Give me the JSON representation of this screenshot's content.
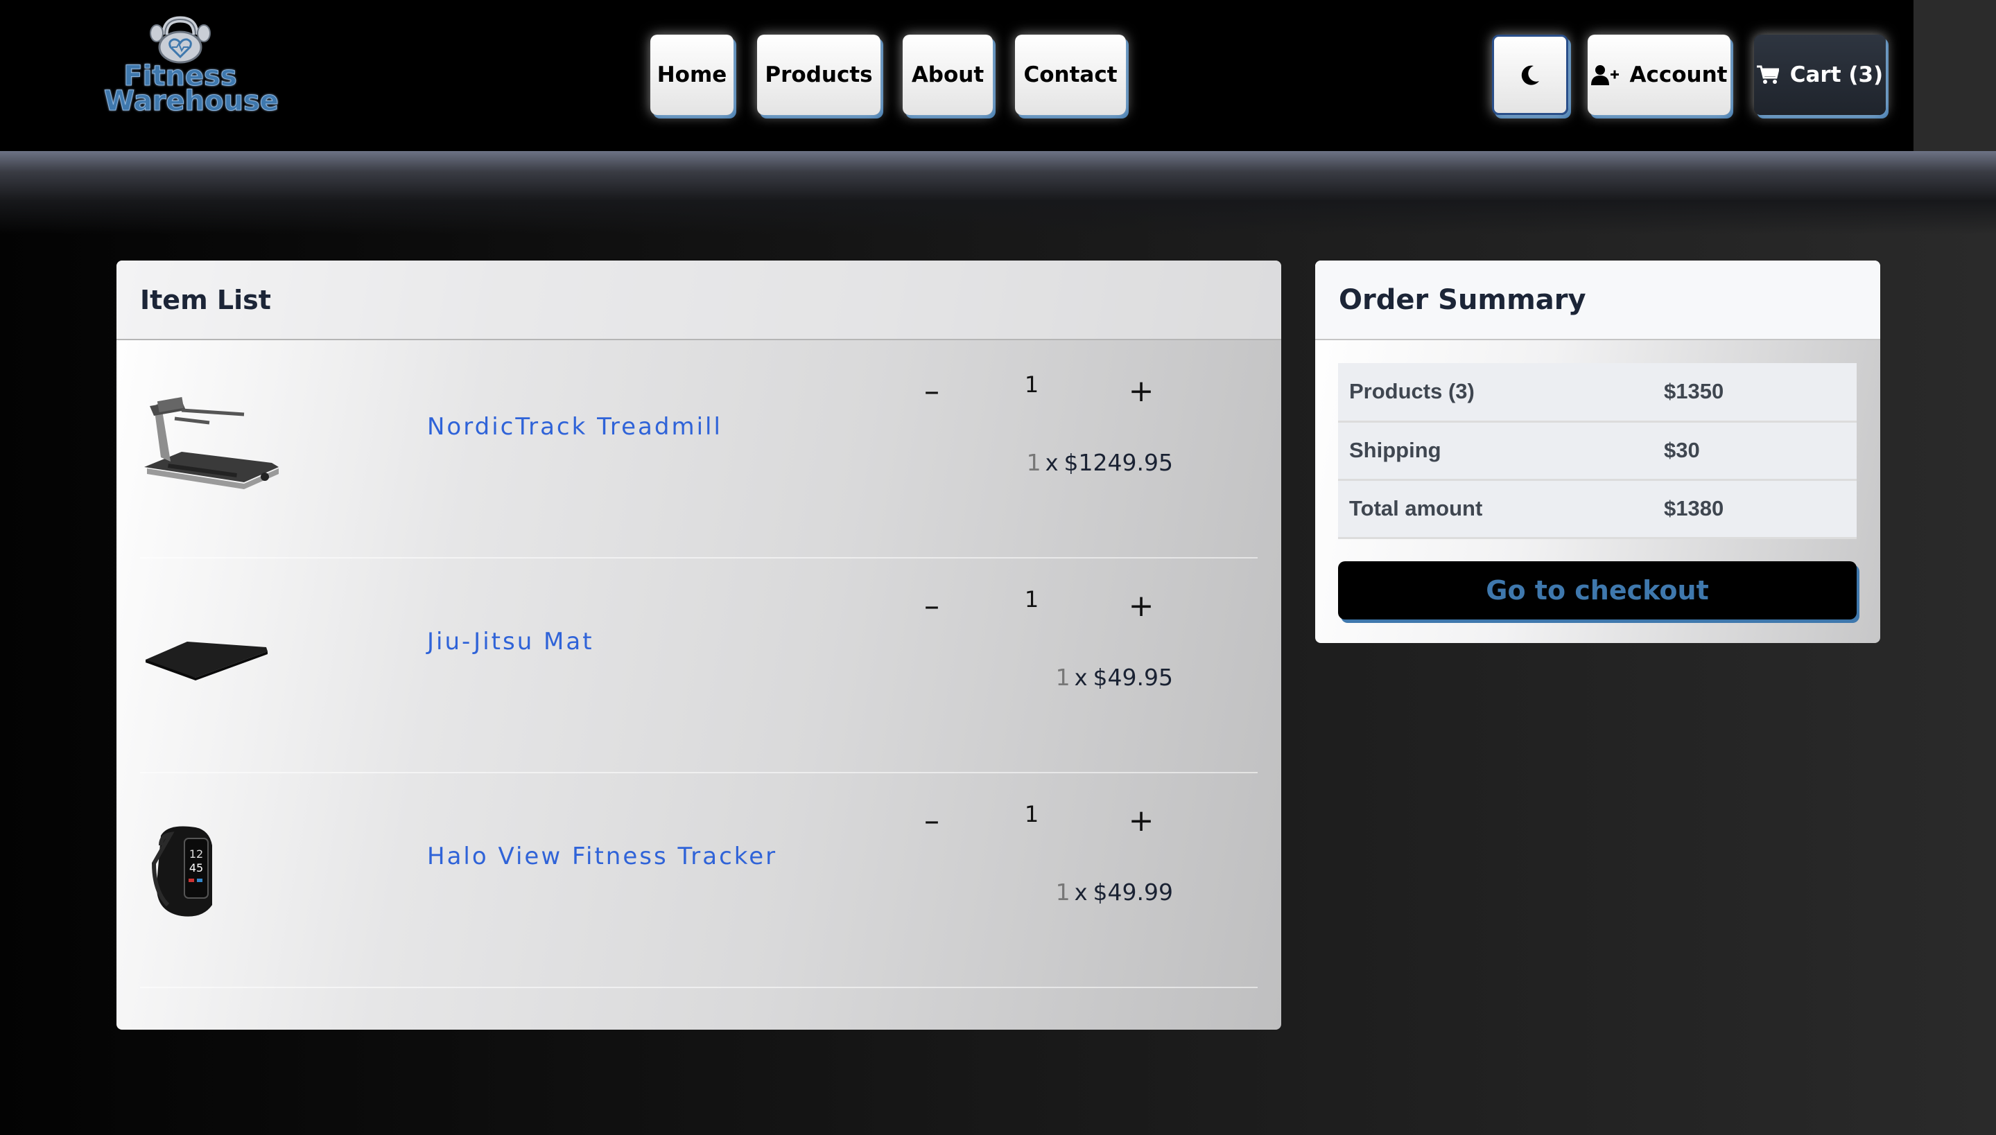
{
  "brand": {
    "line1": "Fitness",
    "line2": "Warehouse"
  },
  "nav": {
    "home": "Home",
    "products": "Products",
    "about": "About",
    "contact": "Contact",
    "mode_icon": "moon-icon",
    "account": "Account",
    "cart": "Cart (3)"
  },
  "item_list": {
    "title": "Item List",
    "items": [
      {
        "name": "NordicTrack Treadmill",
        "quantity": "1",
        "count": "1",
        "times": "x",
        "price": "$1249.95",
        "icon": "treadmill-image"
      },
      {
        "name": "Jiu-Jitsu Mat",
        "quantity": "1",
        "count": "1",
        "times": "x",
        "price": "$49.95",
        "icon": "mat-image"
      },
      {
        "name": "Halo View Fitness Tracker",
        "quantity": "1",
        "count": "1",
        "times": "x",
        "price": "$49.99",
        "icon": "fitness-tracker-image"
      }
    ],
    "minus": "–",
    "plus": "+"
  },
  "summary": {
    "title": "Order Summary",
    "rows": [
      {
        "label": "Products (3)",
        "value": "$1350"
      },
      {
        "label": "Shipping",
        "value": "$30"
      },
      {
        "label": "Total amount",
        "value": "$1380"
      }
    ],
    "checkout": "Go to checkout"
  },
  "tracker_screen": {
    "hours": "12",
    "minutes": "45"
  },
  "colors": {
    "accent": "#3f78ad",
    "link": "#2f63d8",
    "navbar": "#000000"
  }
}
